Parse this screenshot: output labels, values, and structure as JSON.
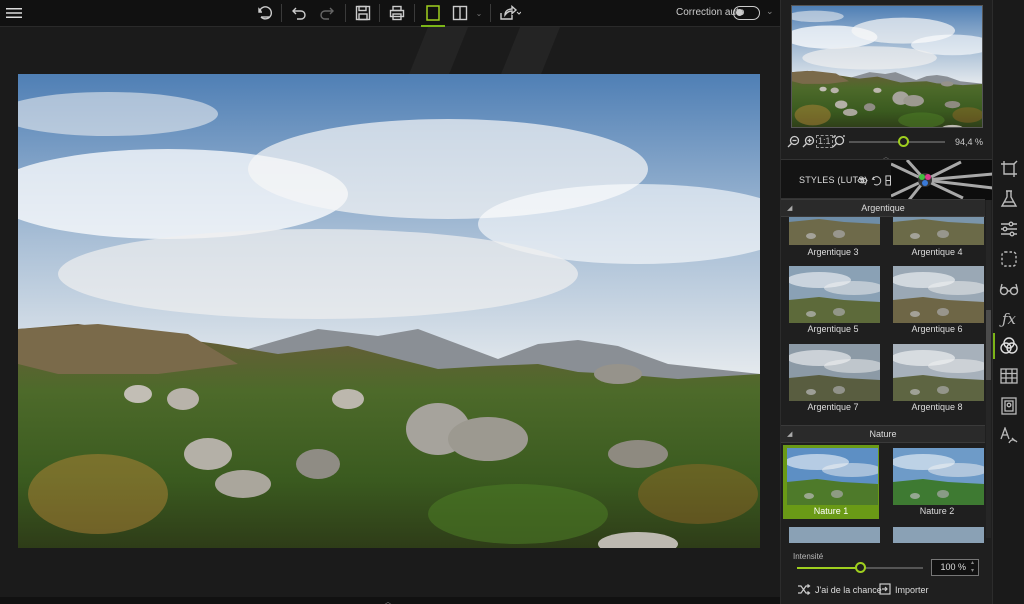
{
  "toolbar": {
    "auto_correction_label": "Correction auto",
    "auto_correction_on": false
  },
  "navigator": {
    "zoom_value": "94,4 %",
    "zoom_fraction": 0.56,
    "fit_label": "1:1"
  },
  "styles": {
    "title": "STYLES (LUTS)",
    "sections": [
      {
        "name": "Argentique",
        "items": [
          "Argentique 3",
          "Argentique 4",
          "Argentique 5",
          "Argentique 6",
          "Argentique 7",
          "Argentique 8"
        ]
      },
      {
        "name": "Nature",
        "items": [
          "Nature 1",
          "Nature 2"
        ]
      }
    ],
    "selected": "Nature 1"
  },
  "intensity": {
    "label": "Intensité",
    "value": "100 %",
    "fraction": 0.5
  },
  "actions": {
    "random_label": "J'ai de la chance",
    "import_label": "Importer"
  },
  "colors": {
    "accent": "#7cb518",
    "selected_tile": "#6a9a16",
    "background": "#1a1a1a"
  },
  "icons": {
    "toolbar": [
      "menu-icon",
      "history-icon",
      "undo-icon",
      "redo-icon",
      "save-icon",
      "print-icon",
      "single-view-icon",
      "split-view-icon",
      "share-icon"
    ],
    "sidebar": [
      "crop-icon",
      "lab-icon",
      "adjust-icon",
      "selection-icon",
      "glasses-icon",
      "fx-icon",
      "color-styles-icon",
      "texture-icon",
      "frame-icon",
      "text-icon"
    ]
  }
}
